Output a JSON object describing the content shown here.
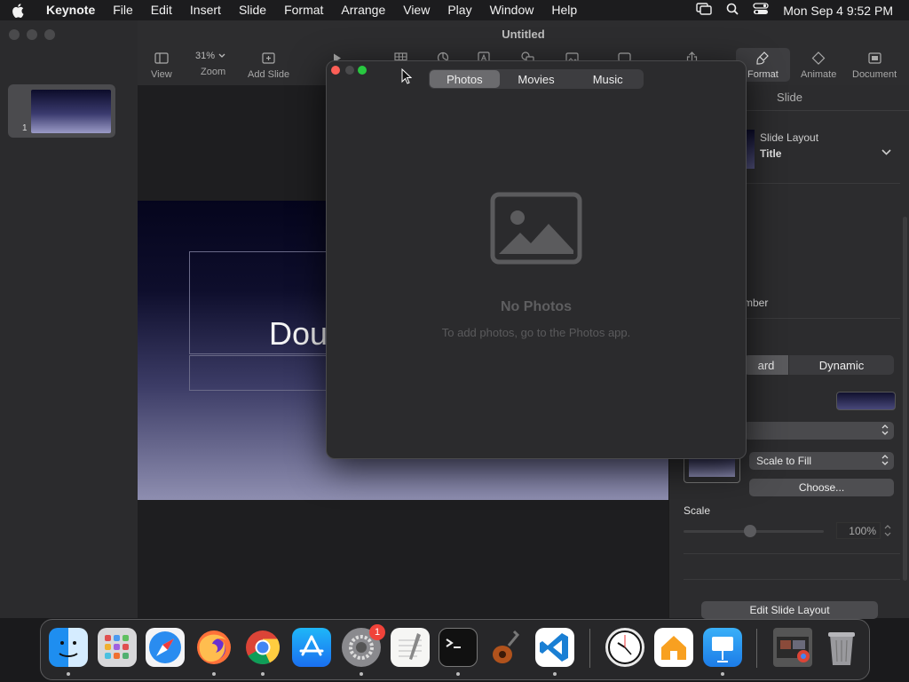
{
  "menubar": {
    "app_name": "Keynote",
    "items": [
      "File",
      "Edit",
      "Insert",
      "Slide",
      "Format",
      "Arrange",
      "View",
      "Play",
      "Window",
      "Help"
    ],
    "clock": "Mon Sep 4  9:52 PM"
  },
  "window": {
    "title": "Untitled",
    "toolbar": {
      "view_label": "View",
      "zoom_value": "31%",
      "zoom_label": "Zoom",
      "add_slide_label": "Add Slide",
      "format_label": "Format",
      "animate_label": "Animate",
      "document_label": "Document"
    },
    "slides": [
      {
        "number": "1"
      }
    ],
    "slide": {
      "title_text": "Dou"
    }
  },
  "inspector": {
    "tab_label": "Slide",
    "layout_label": "Slide Layout",
    "layout_value": "Title",
    "partial_number_text": "mber",
    "segment_left": "ard",
    "segment_right": "Dynamic",
    "fill_mode": "Scale to Fill",
    "choose_label": "Choose...",
    "scale_label": "Scale",
    "scale_value": "100%",
    "edit_layout_label": "Edit Slide Layout"
  },
  "media_browser": {
    "tabs": [
      "Photos",
      "Movies",
      "Music"
    ],
    "selected_tab": "Photos",
    "empty_title": "No Photos",
    "empty_hint": "To add photos, go to the Photos app."
  },
  "dock": {
    "settings_badge": "1"
  }
}
